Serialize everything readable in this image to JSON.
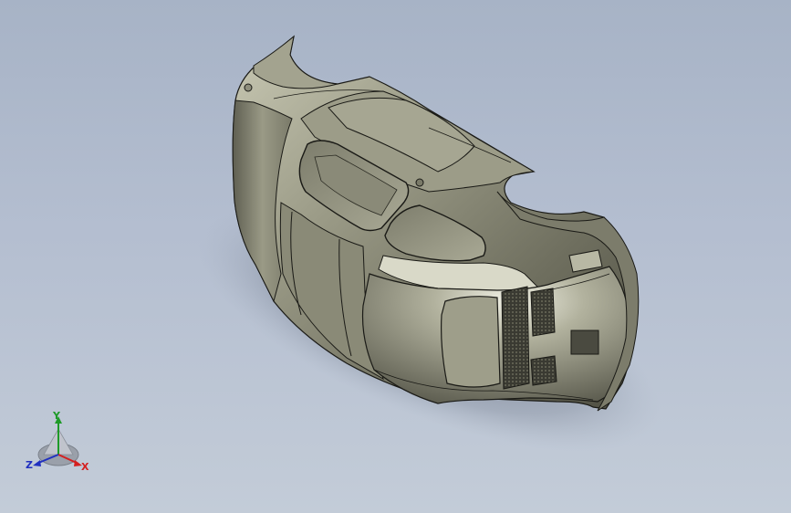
{
  "viewport": {
    "background_top": "#a7b3c6",
    "background_bottom": "#c3ccd8",
    "model_fill": "#8e8e7c",
    "model_edge": "#1a1a16"
  },
  "triad": {
    "x_label": "X",
    "y_label": "Y",
    "z_label": "Z",
    "x_color": "#d42020",
    "y_color": "#1e9a28",
    "z_color": "#2030c0"
  }
}
